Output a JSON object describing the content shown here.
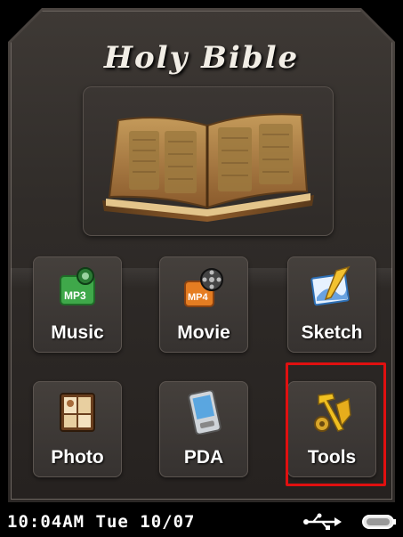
{
  "header": {
    "title": "Holy Bible"
  },
  "menu": {
    "items": [
      {
        "label": "Music",
        "icon": "mp3-icon"
      },
      {
        "label": "Movie",
        "icon": "mp4-film-icon"
      },
      {
        "label": "Sketch",
        "icon": "sketch-pencil-icon"
      },
      {
        "label": "Photo",
        "icon": "photo-album-icon"
      },
      {
        "label": "PDA",
        "icon": "pda-device-icon"
      },
      {
        "label": "Tools",
        "icon": "tools-gear-hammer-icon"
      }
    ],
    "selected": "Tools",
    "highlight_color": "#e01010"
  },
  "status_bar": {
    "time": "10:04AM",
    "day": "Tue",
    "date": "10/07",
    "display": "10:04AM Tue 10/07",
    "icons": [
      "usb-icon",
      "battery-icon"
    ]
  }
}
